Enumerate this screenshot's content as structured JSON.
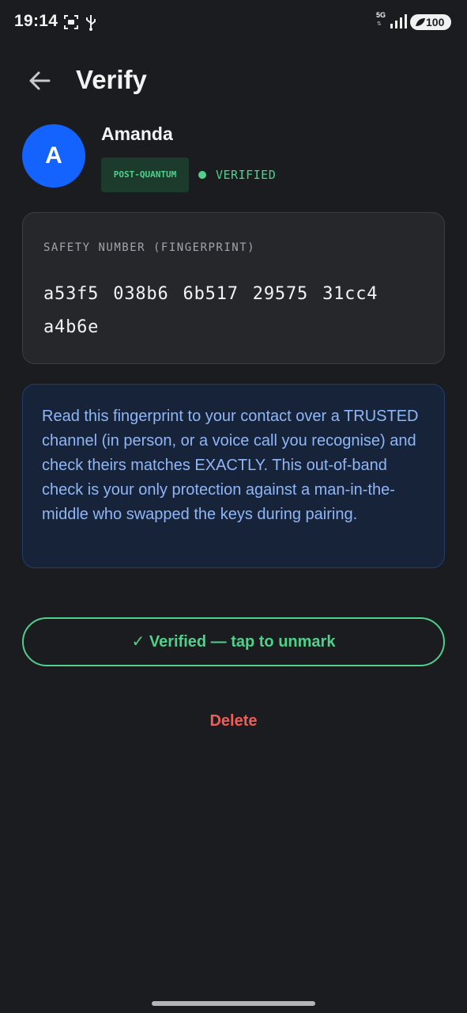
{
  "status_bar": {
    "time": "19:14",
    "network": "5G",
    "battery": "100",
    "icons": [
      "screenshot-icon",
      "usb-icon",
      "signal-icon",
      "battery-saver-icon"
    ]
  },
  "header": {
    "title": "Verify",
    "back_icon": "arrow-left-icon"
  },
  "contact": {
    "avatar_initial": "A",
    "name": "Amanda",
    "badge": "POST-QUANTUM",
    "status": "VERIFIED"
  },
  "fingerprint": {
    "label": "SAFETY NUMBER (FINGERPRINT)",
    "value": "a53f5 038b6 6b517 29575 31cc4 a4b6e"
  },
  "info": {
    "text": "Read this fingerprint to your contact over a TRUSTED channel (in person, or a voice call you recognise) and check theirs matches EXACTLY. This out-of-band check is your only protection against a man-in-the-middle who swapped the keys during pairing."
  },
  "actions": {
    "verify_toggle": "✓ Verified — tap to unmark",
    "delete": "Delete"
  },
  "colors": {
    "background": "#1b1c20",
    "accent_green": "#4fd08b",
    "avatar_blue": "#1463ff",
    "info_text": "#8fb6f7",
    "danger_red": "#ef5d58"
  }
}
